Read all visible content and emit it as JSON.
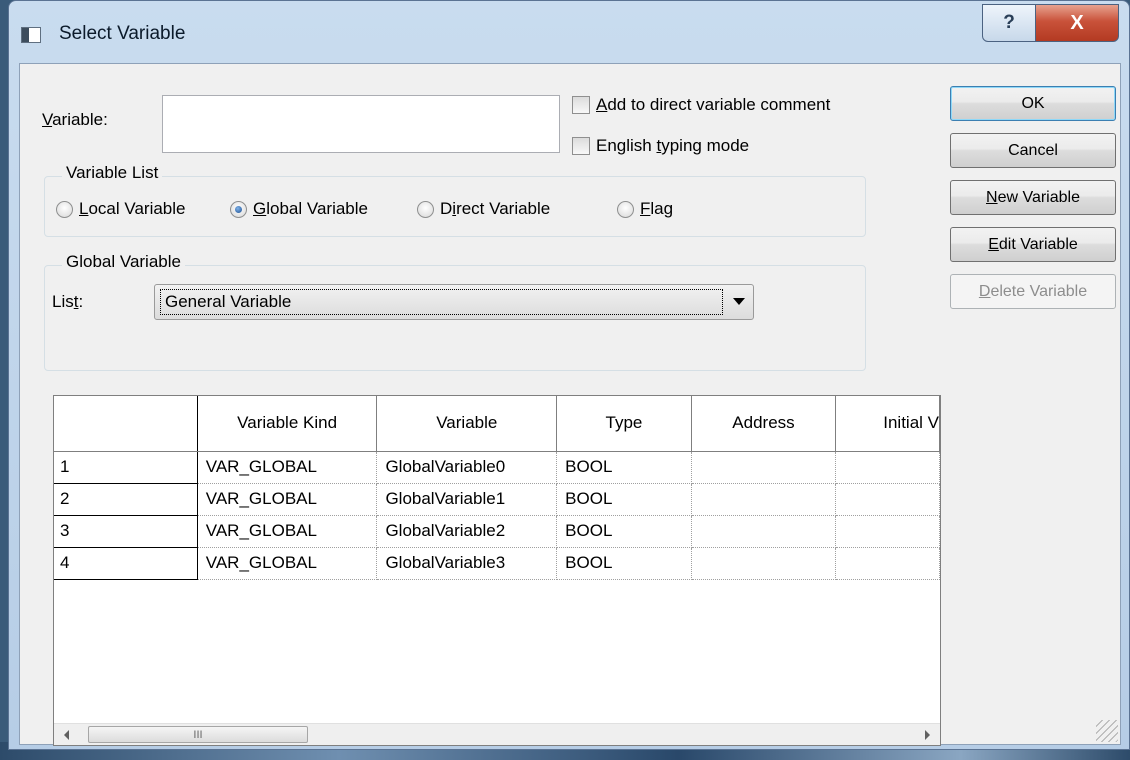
{
  "window": {
    "title": "Select Variable",
    "help_glyph": "?",
    "close_glyph": "X"
  },
  "variable": {
    "label_prefix": "V",
    "label_rest": "ariable:",
    "value": ""
  },
  "options": {
    "add_comment": {
      "prefix": "A",
      "rest": "dd to direct variable comment",
      "checked": false
    },
    "english_typing": {
      "before": "English ",
      "accel": "t",
      "after": "yping mode",
      "checked": false
    }
  },
  "variable_list": {
    "title": "Variable List",
    "local": {
      "accel": "L",
      "rest": "ocal Variable",
      "selected": false
    },
    "global": {
      "accel": "G",
      "rest": "lobal Variable",
      "selected": true
    },
    "direct": {
      "before": "D",
      "accel": "i",
      "after": "rect Variable",
      "selected": false
    },
    "flag": {
      "accel": "F",
      "rest": "lag",
      "selected": false
    }
  },
  "global_variable": {
    "title": "Global Variable",
    "list_label_before": "Lis",
    "list_label_accel": "t",
    "list_label_after": ":",
    "list_value": "General Variable"
  },
  "buttons": {
    "ok": "OK",
    "cancel": "Cancel",
    "new_variable": {
      "accel": "N",
      "rest": "ew Variable"
    },
    "edit_variable": {
      "accel": "E",
      "rest": "dit Variable"
    },
    "delete_variable": {
      "accel": "D",
      "rest": "elete Variable",
      "enabled": false
    }
  },
  "table": {
    "columns": [
      "",
      "Variable Kind",
      "Variable",
      "Type",
      "Address",
      "Initial V"
    ],
    "rows": [
      [
        "1",
        "VAR_GLOBAL",
        "GlobalVariable0",
        "BOOL",
        "",
        ""
      ],
      [
        "2",
        "VAR_GLOBAL",
        "GlobalVariable1",
        "BOOL",
        "",
        ""
      ],
      [
        "3",
        "VAR_GLOBAL",
        "GlobalVariable2",
        "BOOL",
        "",
        ""
      ],
      [
        "4",
        "VAR_GLOBAL",
        "GlobalVariable3",
        "BOOL",
        "",
        ""
      ]
    ]
  },
  "scrollbar": {
    "thumb_grip": "III"
  }
}
